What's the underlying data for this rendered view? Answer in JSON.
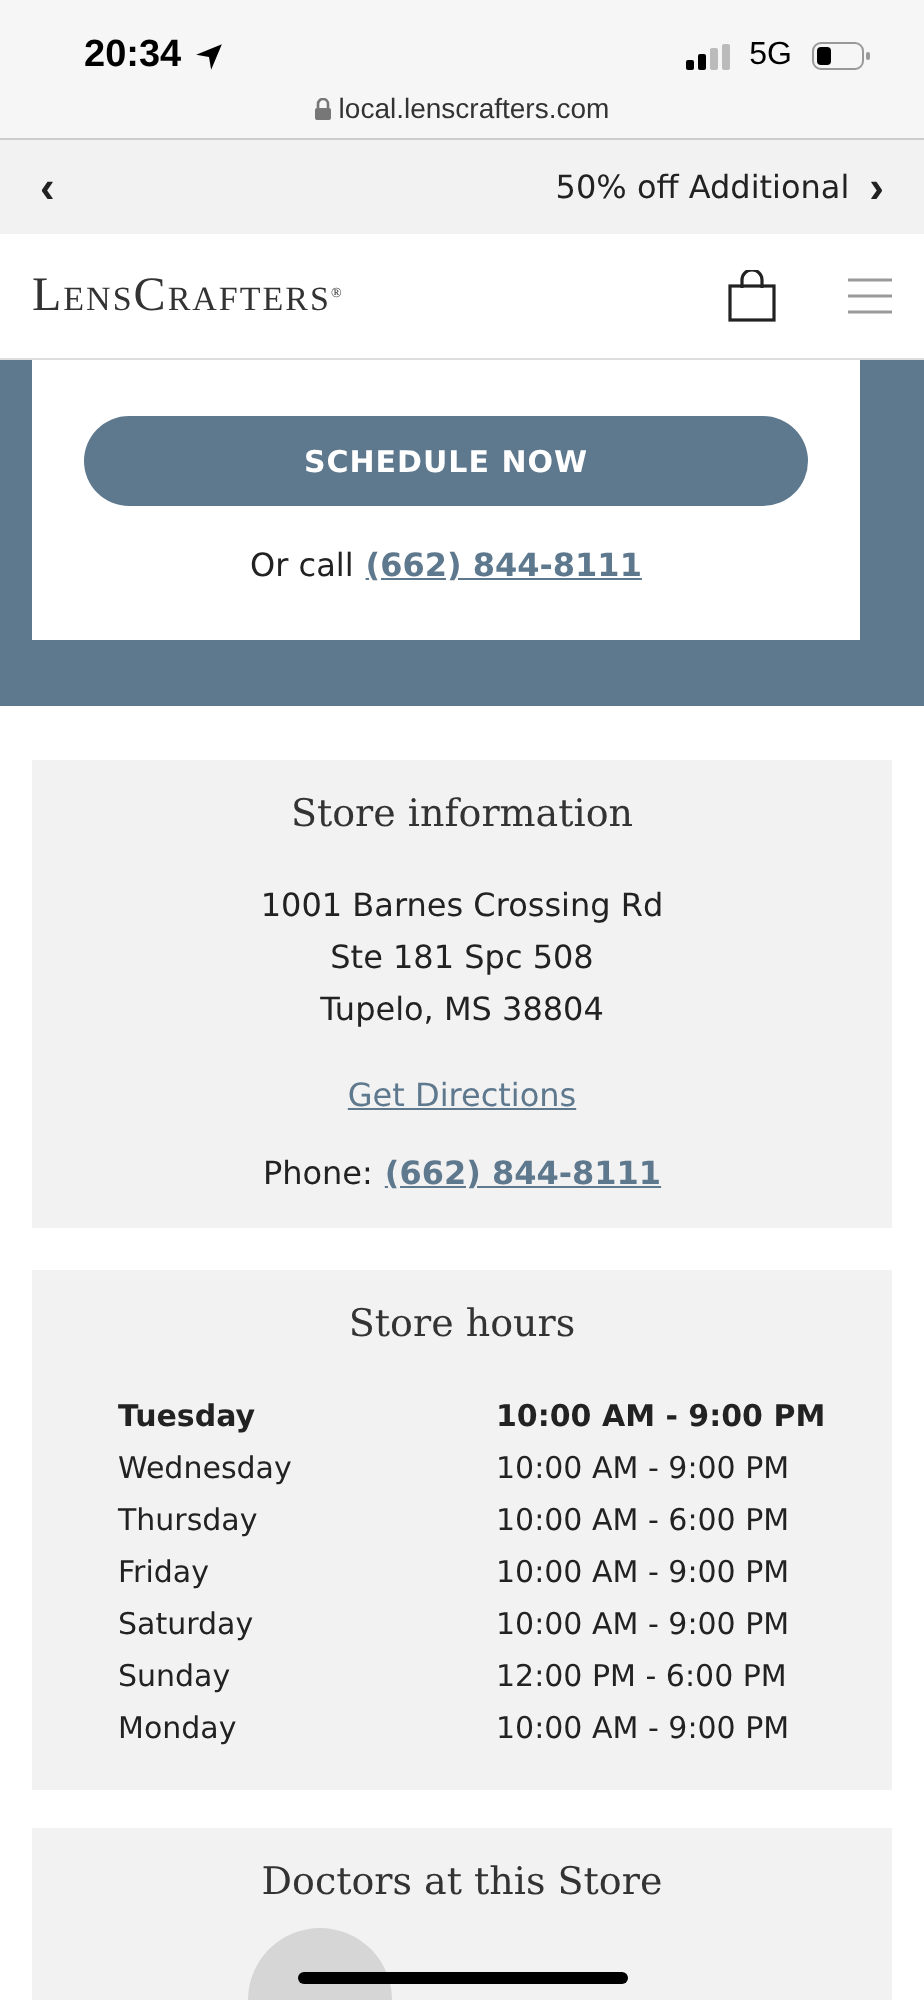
{
  "status_bar": {
    "time": "20:34",
    "network": "5G"
  },
  "address_bar": {
    "url": "local.lenscrafters.com"
  },
  "promo_bar": {
    "prev": "‹",
    "text": "50% off Additional",
    "next": "›"
  },
  "header": {
    "logo_initial_1": "L",
    "logo_rest_1": "ENS",
    "logo_initial_2": "C",
    "logo_rest_2": "RAFTERS",
    "logo_mark": "®"
  },
  "booking": {
    "button": "SCHEDULE NOW",
    "call_label": "Or call",
    "call_phone": "(662) 844-8111"
  },
  "store_information": {
    "title": "Store information",
    "address": [
      "1001 Barnes Crossing Rd",
      "Ste 181 Spc 508",
      "Tupelo, MS 38804"
    ],
    "directions": "Get Directions",
    "phone_label": "Phone:",
    "phone": "(662) 844-8111"
  },
  "store_hours": {
    "title": "Store hours",
    "days": [
      {
        "day": "Tuesday",
        "hours": "10:00 AM - 9:00 PM",
        "current": true
      },
      {
        "day": "Wednesday",
        "hours": "10:00 AM - 9:00 PM",
        "current": false
      },
      {
        "day": "Thursday",
        "hours": "10:00 AM - 6:00 PM",
        "current": false
      },
      {
        "day": "Friday",
        "hours": "10:00 AM - 9:00 PM",
        "current": false
      },
      {
        "day": "Saturday",
        "hours": "10:00 AM - 9:00 PM",
        "current": false
      },
      {
        "day": "Sunday",
        "hours": "12:00 PM - 6:00 PM",
        "current": false
      },
      {
        "day": "Monday",
        "hours": "10:00 AM - 9:00 PM",
        "current": false
      }
    ]
  },
  "doctors": {
    "title": "Doctors at this Store"
  }
}
